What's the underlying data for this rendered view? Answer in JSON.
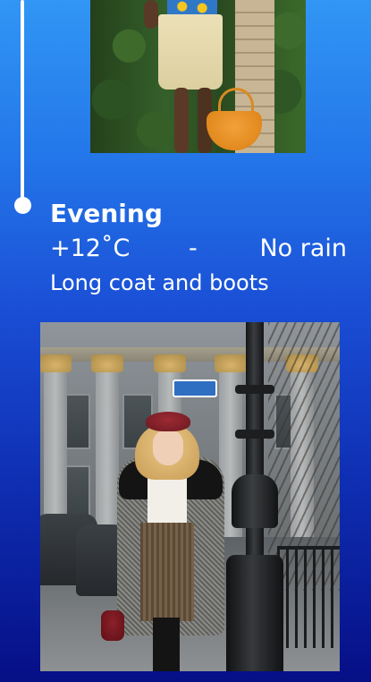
{
  "evening": {
    "title": "Evening",
    "temperature": "+12˚C",
    "separator": "-",
    "precipitation": "No rain",
    "outfit": "Long coat and boots"
  },
  "colors": {
    "gradient_top": "#3196f4",
    "gradient_bottom": "#060f86",
    "text": "#ffffff",
    "timeline": "#ffffff"
  }
}
